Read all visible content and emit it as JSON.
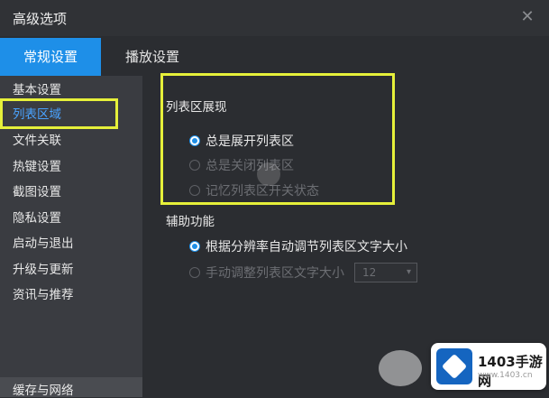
{
  "window": {
    "title": "高级选项",
    "close_glyph": "✕"
  },
  "tabs": [
    {
      "label": "常规设置"
    },
    {
      "label": "播放设置"
    }
  ],
  "sidebar": {
    "items": [
      {
        "label": "基本设置"
      },
      {
        "label": "列表区域"
      },
      {
        "label": "文件关联"
      },
      {
        "label": "热键设置"
      },
      {
        "label": "截图设置"
      },
      {
        "label": "隐私设置"
      },
      {
        "label": "启动与退出"
      },
      {
        "label": "升级与更新"
      },
      {
        "label": "资讯与推荐"
      }
    ],
    "bottom": {
      "label": "缓存与网络"
    }
  },
  "list_display": {
    "title": "列表区展现",
    "options": [
      {
        "label": "总是展开列表区",
        "checked": true
      },
      {
        "label": "总是关闭列表区",
        "checked": false
      },
      {
        "label": "记忆列表区开关状态",
        "checked": false
      }
    ]
  },
  "assist": {
    "title": "辅助功能",
    "options": [
      {
        "label": "根据分辨率自动调节列表区文字大小",
        "checked": true
      },
      {
        "label": "手动调整列表区文字大小",
        "checked": false
      }
    ],
    "font_size_value": "12"
  },
  "highlight_color": "#e6f03a",
  "accent_color": "#1e8fe8",
  "logo": {
    "text": "1403手游网",
    "sub": "www.1403.cn"
  }
}
